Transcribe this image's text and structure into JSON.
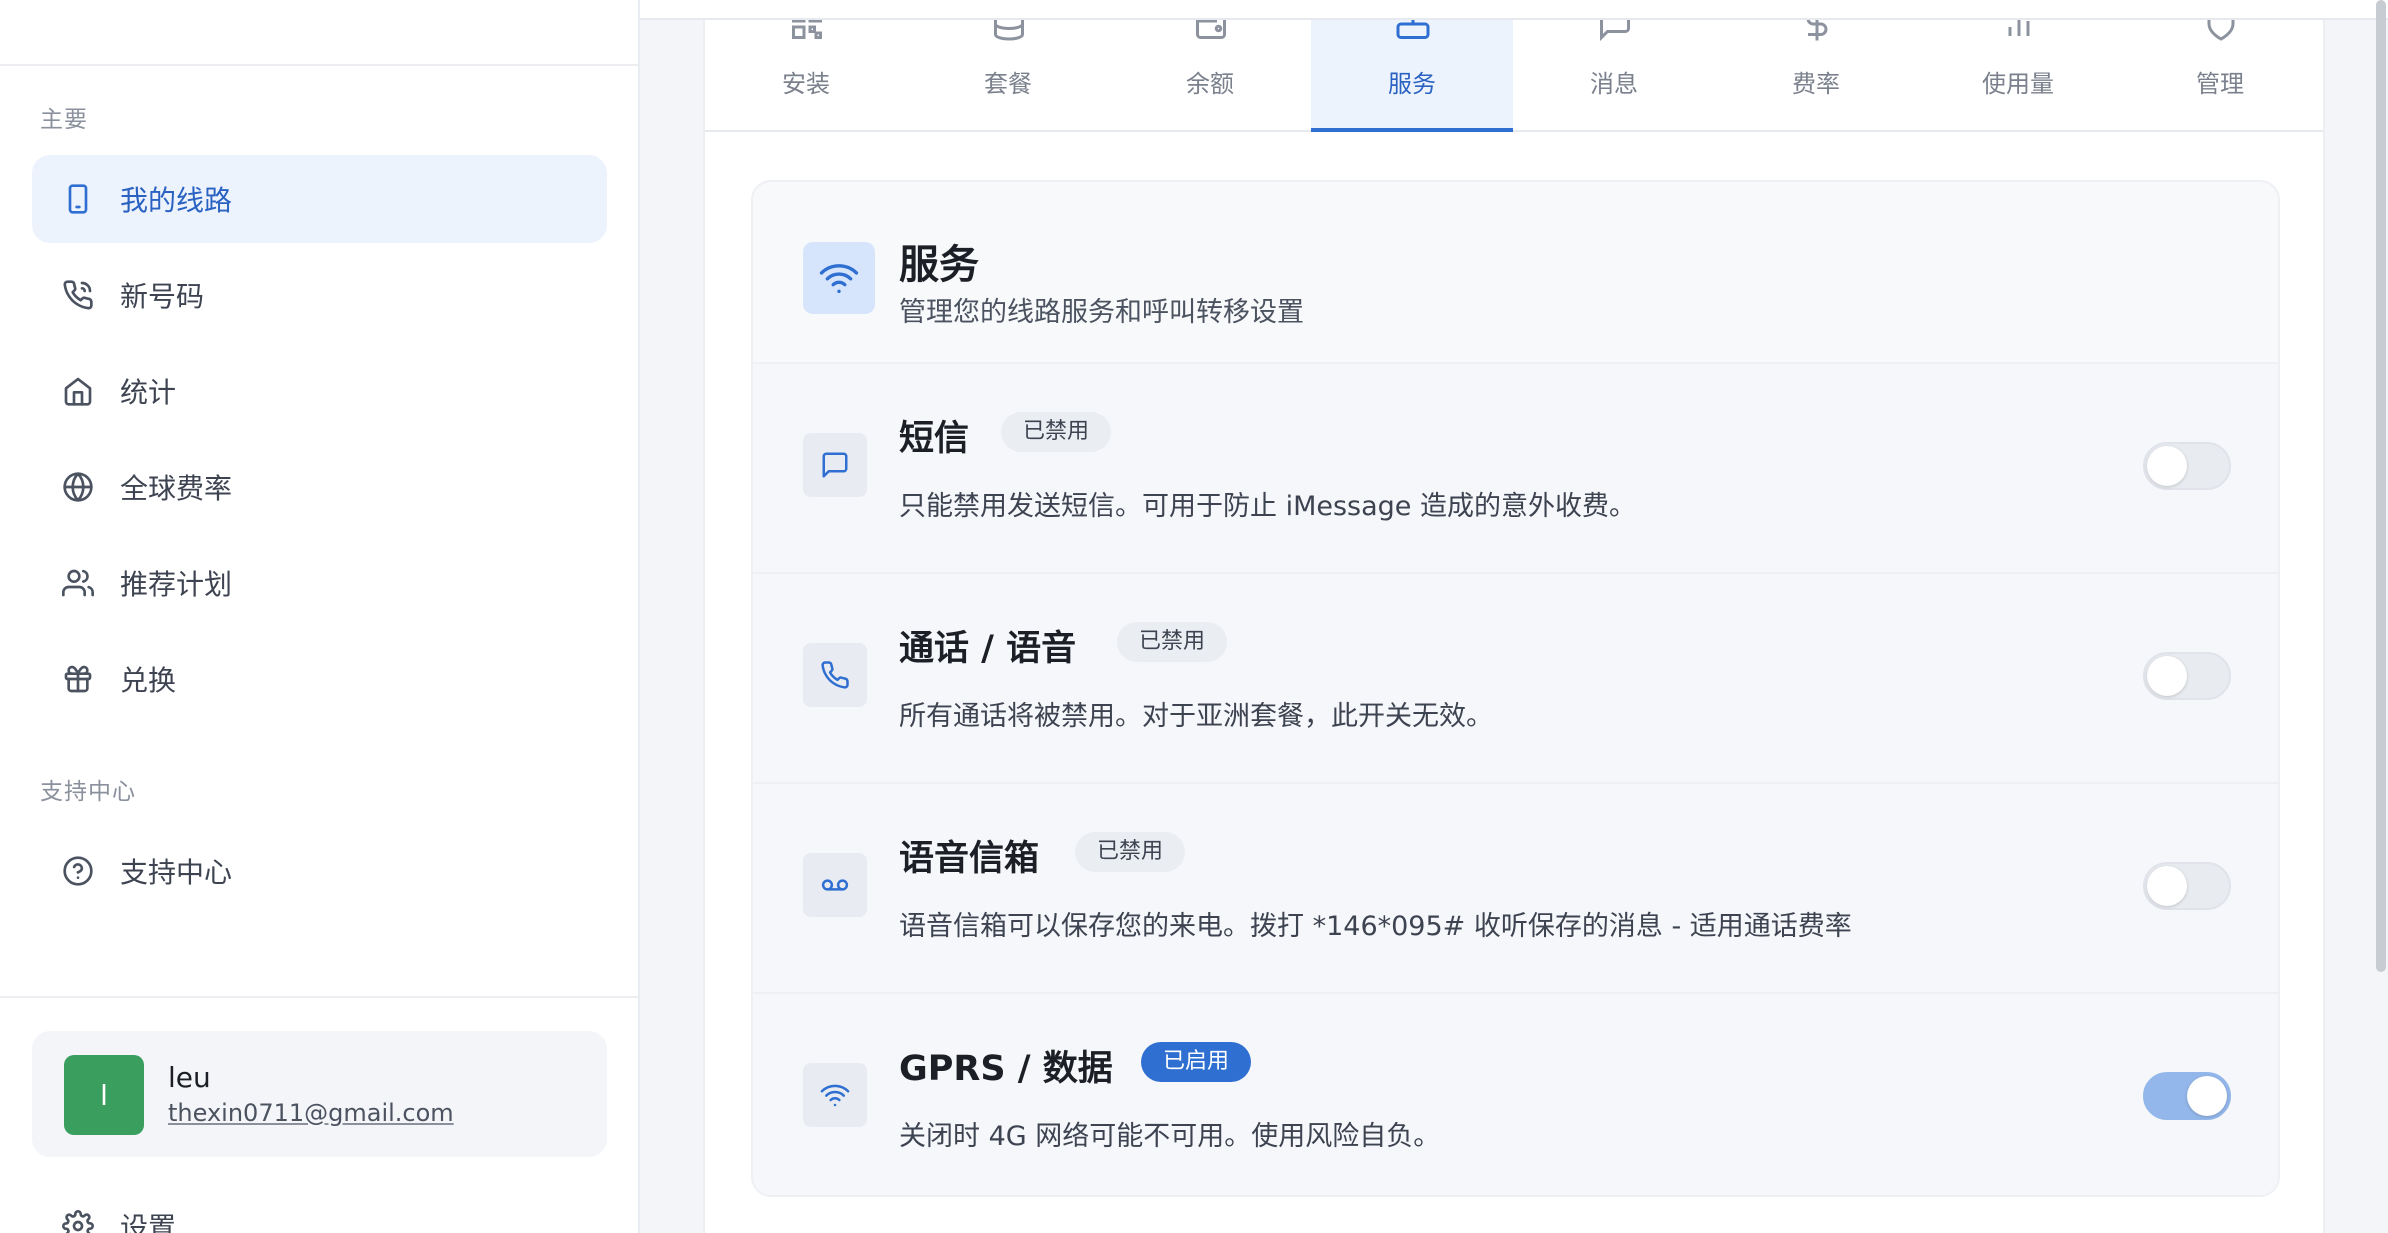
{
  "sidebar": {
    "section_main": "主要",
    "items": [
      {
        "label": "我的线路",
        "icon": "smartphone-icon",
        "active": true
      },
      {
        "label": "新号码",
        "icon": "phone-icon"
      },
      {
        "label": "统计",
        "icon": "home-icon"
      },
      {
        "label": "全球费率",
        "icon": "globe-icon"
      },
      {
        "label": "推荐计划",
        "icon": "users-icon"
      },
      {
        "label": "兑换",
        "icon": "gift-icon"
      }
    ],
    "section_support": "支持中心",
    "support_item": {
      "label": "支持中心",
      "icon": "help-circle-icon"
    },
    "user": {
      "initial": "l",
      "name": "leu",
      "email": "thexin0711@gmail.com"
    },
    "settings_label": "设置"
  },
  "tabs": [
    {
      "label": "安装",
      "icon": "qr-code-icon"
    },
    {
      "label": "套餐",
      "icon": "database-icon"
    },
    {
      "label": "余额",
      "icon": "wallet-icon"
    },
    {
      "label": "服务",
      "icon": "router-icon",
      "active": true
    },
    {
      "label": "消息",
      "icon": "message-icon"
    },
    {
      "label": "费率",
      "icon": "dollar-icon"
    },
    {
      "label": "使用量",
      "icon": "bar-chart-icon"
    },
    {
      "label": "管理",
      "icon": "shield-icon"
    }
  ],
  "services": {
    "title": "服务",
    "subtitle": "管理您的线路服务和呼叫转移设置",
    "items": [
      {
        "title": "短信",
        "status": "已禁用",
        "enabled": false,
        "description": "只能禁用发送短信。可用于防止 iMessage 造成的意外收费。",
        "icon": "message-square-icon"
      },
      {
        "title": "通话 / 语音",
        "status": "已禁用",
        "enabled": false,
        "description": "所有通话将被禁用。对于亚洲套餐，此开关无效。",
        "icon": "phone-icon"
      },
      {
        "title": "语音信箱",
        "status": "已禁用",
        "enabled": false,
        "description": "语音信箱可以保存您的来电。拨打 *146*095# 收听保存的消息 - 适用通话费率",
        "icon": "voicemail-icon"
      },
      {
        "title": "GPRS / 数据",
        "status": "已启用",
        "enabled": true,
        "description": "关闭时 4G 网络可能不可用。使用风险自负。",
        "icon": "wifi-icon"
      }
    ]
  },
  "colors": {
    "accent": "#2f6fd1",
    "active_bg": "#edf3fd",
    "avatar": "#3a9e5f",
    "toggle_on": "#93b7ea"
  }
}
